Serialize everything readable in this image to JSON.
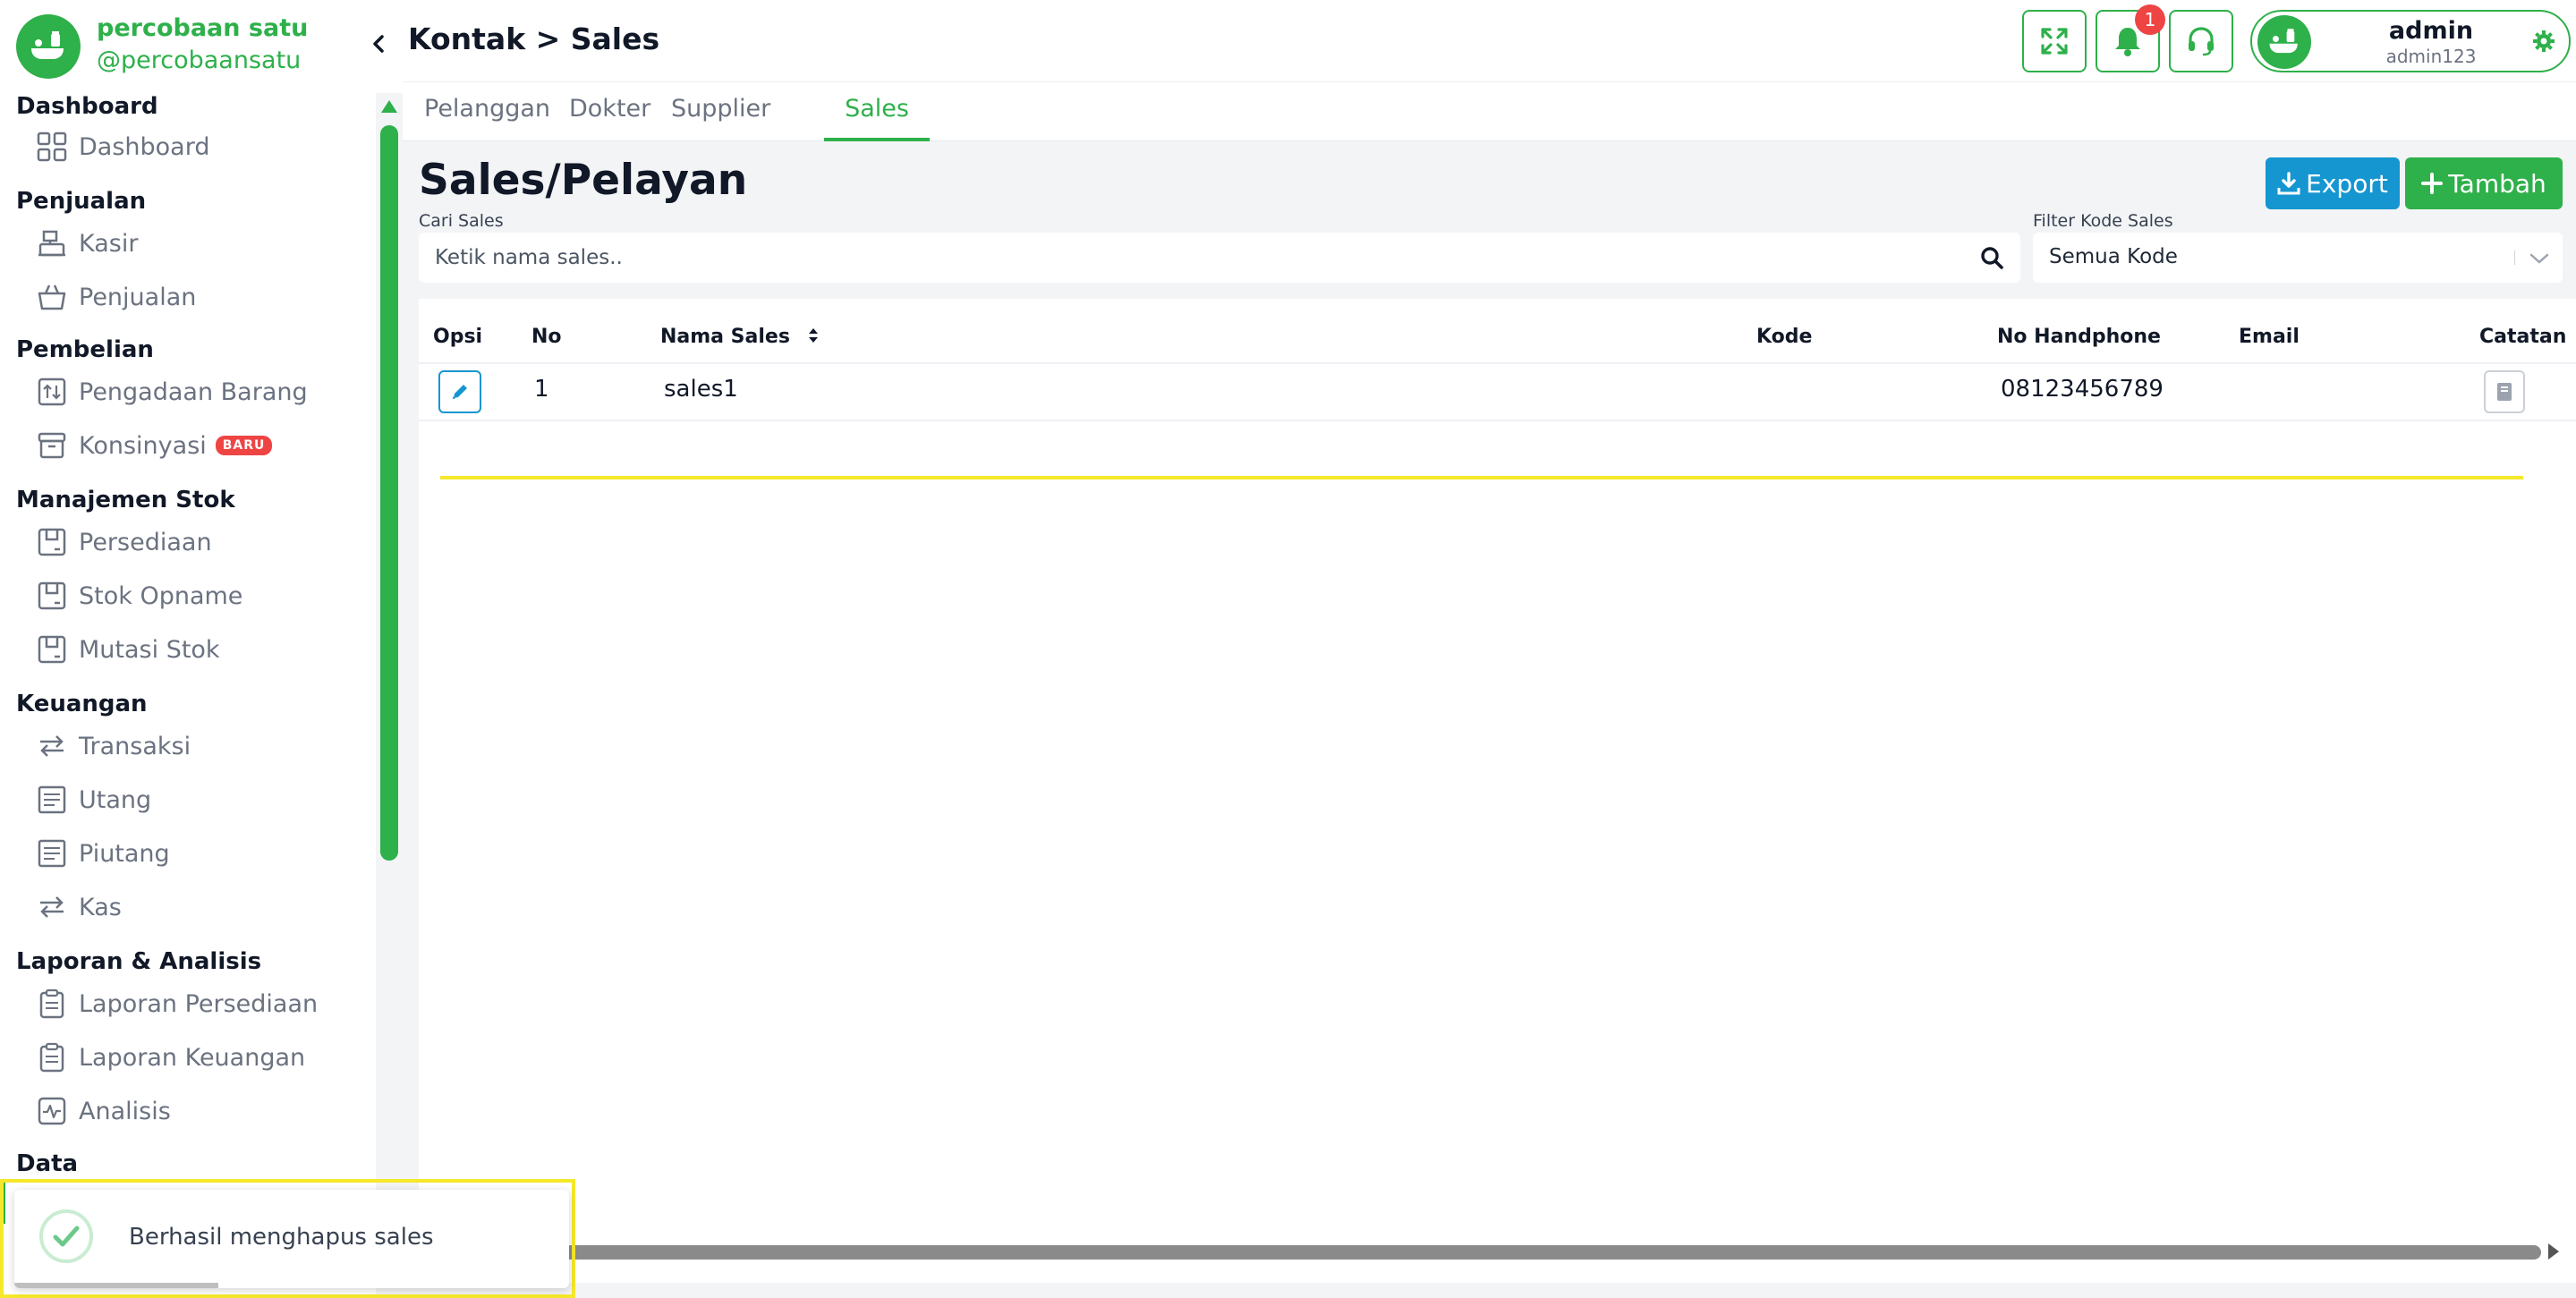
{
  "brand": {
    "name": "percobaan satu",
    "handle": "@percobaansatu",
    "logo_icon": "shop-logo-icon",
    "color": "#2eb04a"
  },
  "sidebar": {
    "sections": [
      {
        "title": "Dashboard",
        "items": [
          {
            "label": "Dashboard",
            "icon": "grid-icon"
          }
        ]
      },
      {
        "title": "Penjualan",
        "items": [
          {
            "label": "Kasir",
            "icon": "cash-register-icon"
          },
          {
            "label": "Penjualan",
            "icon": "basket-icon"
          }
        ]
      },
      {
        "title": "Pembelian",
        "items": [
          {
            "label": "Pengadaan Barang",
            "icon": "inbox-arrows-icon"
          },
          {
            "label": "Konsinyasi",
            "icon": "archive-box-icon",
            "badge": "BARU"
          }
        ]
      },
      {
        "title": "Manajemen Stok",
        "items": [
          {
            "label": "Persediaan",
            "icon": "box-icon"
          },
          {
            "label": "Stok Opname",
            "icon": "box-icon"
          },
          {
            "label": "Mutasi Stok",
            "icon": "box-icon"
          }
        ]
      },
      {
        "title": "Keuangan",
        "items": [
          {
            "label": "Transaksi",
            "icon": "transfer-icon"
          },
          {
            "label": "Utang",
            "icon": "receipt-icon"
          },
          {
            "label": "Piutang",
            "icon": "receipt-icon"
          },
          {
            "label": "Kas",
            "icon": "transfer-icon"
          }
        ]
      },
      {
        "title": "Laporan & Analisis",
        "items": [
          {
            "label": "Laporan Persediaan",
            "icon": "clipboard-icon"
          },
          {
            "label": "Laporan Keuangan",
            "icon": "clipboard-icon"
          },
          {
            "label": "Analisis",
            "icon": "activity-icon"
          }
        ]
      },
      {
        "title": "Data",
        "items": []
      }
    ]
  },
  "header": {
    "breadcrumb": "Kontak > Sales",
    "notification_count": "1",
    "user": {
      "name": "admin",
      "username": "admin123"
    }
  },
  "tabs": [
    {
      "label": "Pelanggan",
      "active": false
    },
    {
      "label": "Dokter",
      "active": false
    },
    {
      "label": "Supplier",
      "active": false
    },
    {
      "label": "Sales",
      "active": true
    }
  ],
  "main": {
    "title": "Sales/Pelayan",
    "export_label": "Export",
    "add_label": "Tambah",
    "search_label": "Cari Sales",
    "search_placeholder": "Ketik nama sales..",
    "filter_label": "Filter Kode Sales",
    "filter_value": "Semua Kode"
  },
  "table": {
    "columns": [
      "Opsi",
      "No",
      "Nama Sales",
      "Kode",
      "No Handphone",
      "Email",
      "Catatan"
    ],
    "rows": [
      {
        "no": "1",
        "nama": "sales1",
        "kode": "",
        "hp": "08123456789",
        "email": ""
      }
    ]
  },
  "toast": {
    "message": "Berhasil menghapus sales",
    "type": "success"
  },
  "colors": {
    "primary": "#2eb04a",
    "info": "#1596d1",
    "danger": "#ef4444",
    "highlight": "#f5e82a"
  }
}
